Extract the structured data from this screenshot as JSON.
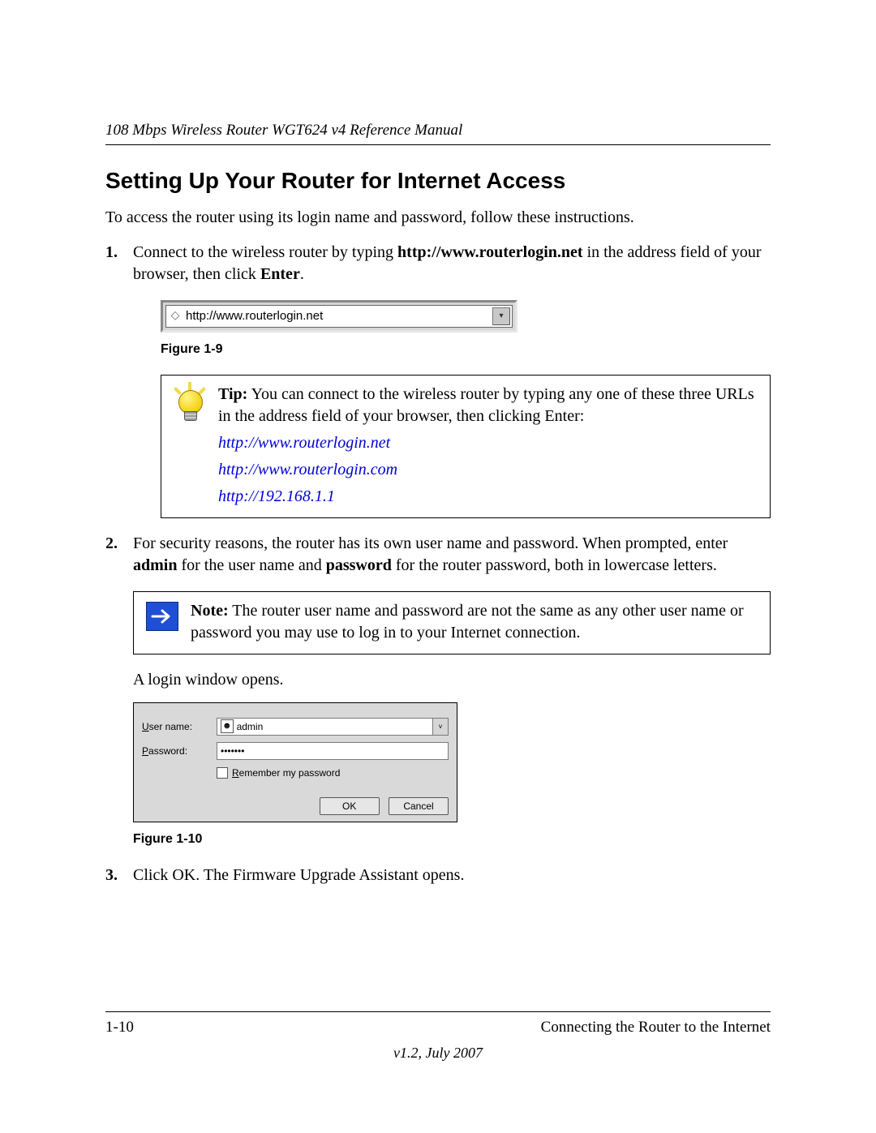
{
  "header": {
    "running": "108 Mbps Wireless Router WGT624 v4 Reference Manual"
  },
  "title": "Setting Up Your Router for Internet Access",
  "intro": "To access the router using its login name and password, follow these instructions.",
  "step1": {
    "pre": "Connect to the wireless router by typing ",
    "url": "http://www.routerlogin.net",
    "mid": " in the address field of your browser, then click ",
    "enter": "Enter",
    "post": "."
  },
  "addr_bar_text": "http://www.routerlogin.net",
  "fig1_caption": "Figure 1-9",
  "tip": {
    "label": "Tip:",
    "text": " You can connect to the wireless router by typing any one of these three URLs in the address field of your browser, then clicking Enter:",
    "links": [
      "http://www.routerlogin.net",
      "http://www.routerlogin.com",
      "http://192.168.1.1"
    ]
  },
  "step2": {
    "pre": "For security reasons, the router has its own user name and password. When prompted, enter ",
    "admin": "admin",
    "mid": " for the user name and ",
    "password": "password",
    "post": " for the router password, both in lowercase letters."
  },
  "note": {
    "label": "Note:",
    "text": " The router user name and password are not the same as any other user name or password you may use to log in to your Internet connection."
  },
  "login_opens": "A login window opens.",
  "login": {
    "user_label_u": "U",
    "user_label_rest": "ser name:",
    "pass_label_p": "P",
    "pass_label_rest": "assword:",
    "user_value": "admin",
    "pass_value": "•••••••",
    "remember_r": "R",
    "remember_rest": "emember my password",
    "ok": "OK",
    "cancel": "Cancel"
  },
  "fig2_caption": "Figure 1-10",
  "step3": "Click OK. The Firmware Upgrade Assistant opens.",
  "footer": {
    "left": "1-10",
    "right": "Connecting the Router to the Internet",
    "center": "v1.2, July 2007"
  }
}
